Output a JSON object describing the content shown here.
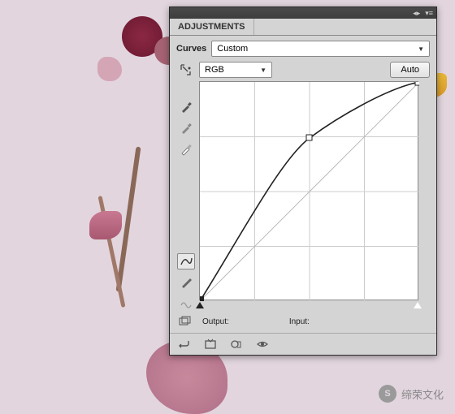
{
  "panel": {
    "tab_label": "ADJUSTMENTS",
    "curves_label": "Curves",
    "preset": "Custom",
    "channel": "RGB",
    "auto_label": "Auto",
    "output_label": "Output:",
    "input_label": "Input:"
  },
  "chart_data": {
    "type": "line",
    "title": "Curves",
    "xlabel": "Input",
    "ylabel": "Output",
    "xlim": [
      0,
      255
    ],
    "ylim": [
      0,
      255
    ],
    "series": [
      {
        "name": "curve",
        "points": [
          {
            "x": 0,
            "y": 0
          },
          {
            "x": 127,
            "y": 190
          },
          {
            "x": 255,
            "y": 255
          }
        ]
      },
      {
        "name": "baseline",
        "points": [
          {
            "x": 0,
            "y": 0
          },
          {
            "x": 255,
            "y": 255
          }
        ]
      }
    ],
    "control_point": {
      "x": 127,
      "y": 190
    }
  },
  "watermark": {
    "icon_text": "S",
    "text": "缔荣文化"
  }
}
